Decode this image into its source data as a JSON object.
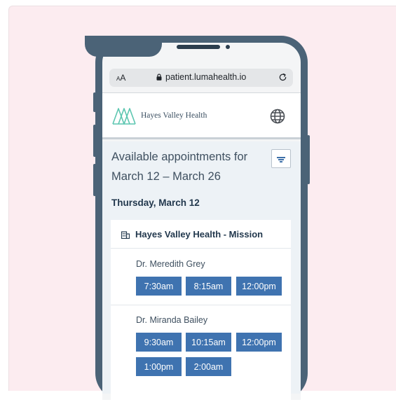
{
  "browser": {
    "text_size_label": "AA",
    "url": "patient.lumahealth.io"
  },
  "header": {
    "brand_name": "Hayes Valley Health"
  },
  "page": {
    "title_line1": "Available appointments for",
    "title_line2": "March 12 – March 26",
    "date_heading": "Thursday, March 12"
  },
  "location": {
    "name": "Hayes Valley Health - Mission"
  },
  "providers": [
    {
      "name": "Dr. Meredith Grey",
      "slots": [
        "7:30am",
        "8:15am",
        "12:00pm"
      ]
    },
    {
      "name": "Dr. Miranda Bailey",
      "slots": [
        "9:30am",
        "10:15am",
        "12:00pm",
        "1:00pm",
        "2:00am"
      ]
    }
  ],
  "colors": {
    "background": "#fcecf0",
    "phone_frame": "#4b6377",
    "slot_button": "#3f73b0",
    "logo": "#5cc6b0"
  },
  "icons": [
    "lock-icon",
    "reload-icon",
    "globe-icon",
    "filter-icon",
    "building-icon"
  ]
}
